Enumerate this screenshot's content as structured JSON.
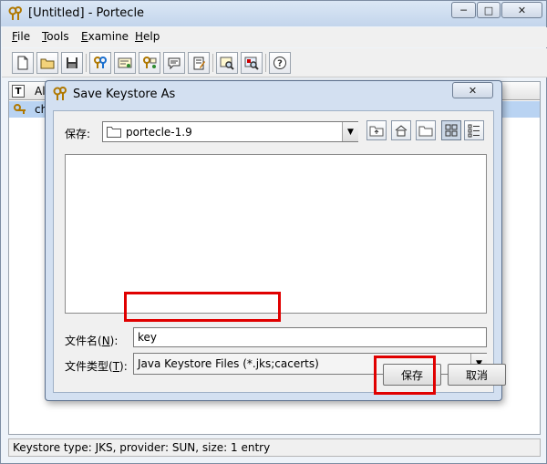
{
  "window": {
    "title": "[Untitled] - Portecle",
    "minimize": "─",
    "maximize": "□",
    "close": "✕"
  },
  "menu": {
    "file": {
      "accel": "F",
      "rest": "ile"
    },
    "tools": {
      "accel": "T",
      "rest": "ools"
    },
    "examine": {
      "accel": "E",
      "rest": "xamine"
    },
    "help": {
      "accel": "H",
      "rest": "elp"
    }
  },
  "toolbar": {
    "icons": [
      "new-keystore-icon",
      "open-keystore-icon",
      "save-keystore-icon",
      "generate-keypair-icon",
      "import-trusted-cert-icon",
      "import-keypair-icon",
      "set-password-icon",
      "keystore-report-icon",
      "examine-certificate-icon",
      "examine-ssl-icon",
      "help-icon"
    ]
  },
  "table": {
    "type_header": "T",
    "alias_header": "Al",
    "rows": [
      {
        "alias": "ch"
      }
    ]
  },
  "status": {
    "text": "Keystore type: JKS, provider: SUN, size: 1 entry"
  },
  "dialog": {
    "title": "Save Keystore As",
    "save_in_label": "保存:",
    "save_in_value": "portecle-1.9",
    "file_name_label_pre": "文件名(",
    "file_name_label_accel": "N",
    "file_name_label_post": "):",
    "file_name_value": "key",
    "file_type_label_pre": "文件类型(",
    "file_type_label_accel": "T",
    "file_type_label_post": "):",
    "file_type_value": "Java Keystore Files (*.jks;cacerts)",
    "save_button": "保存",
    "cancel_button": "取消",
    "nav_icons": [
      "up-folder-icon",
      "home-icon",
      "new-folder-icon",
      "list-view-icon",
      "details-view-icon"
    ]
  },
  "colors": {
    "highlight": "#e00000",
    "selection": "#b9d3f2"
  }
}
